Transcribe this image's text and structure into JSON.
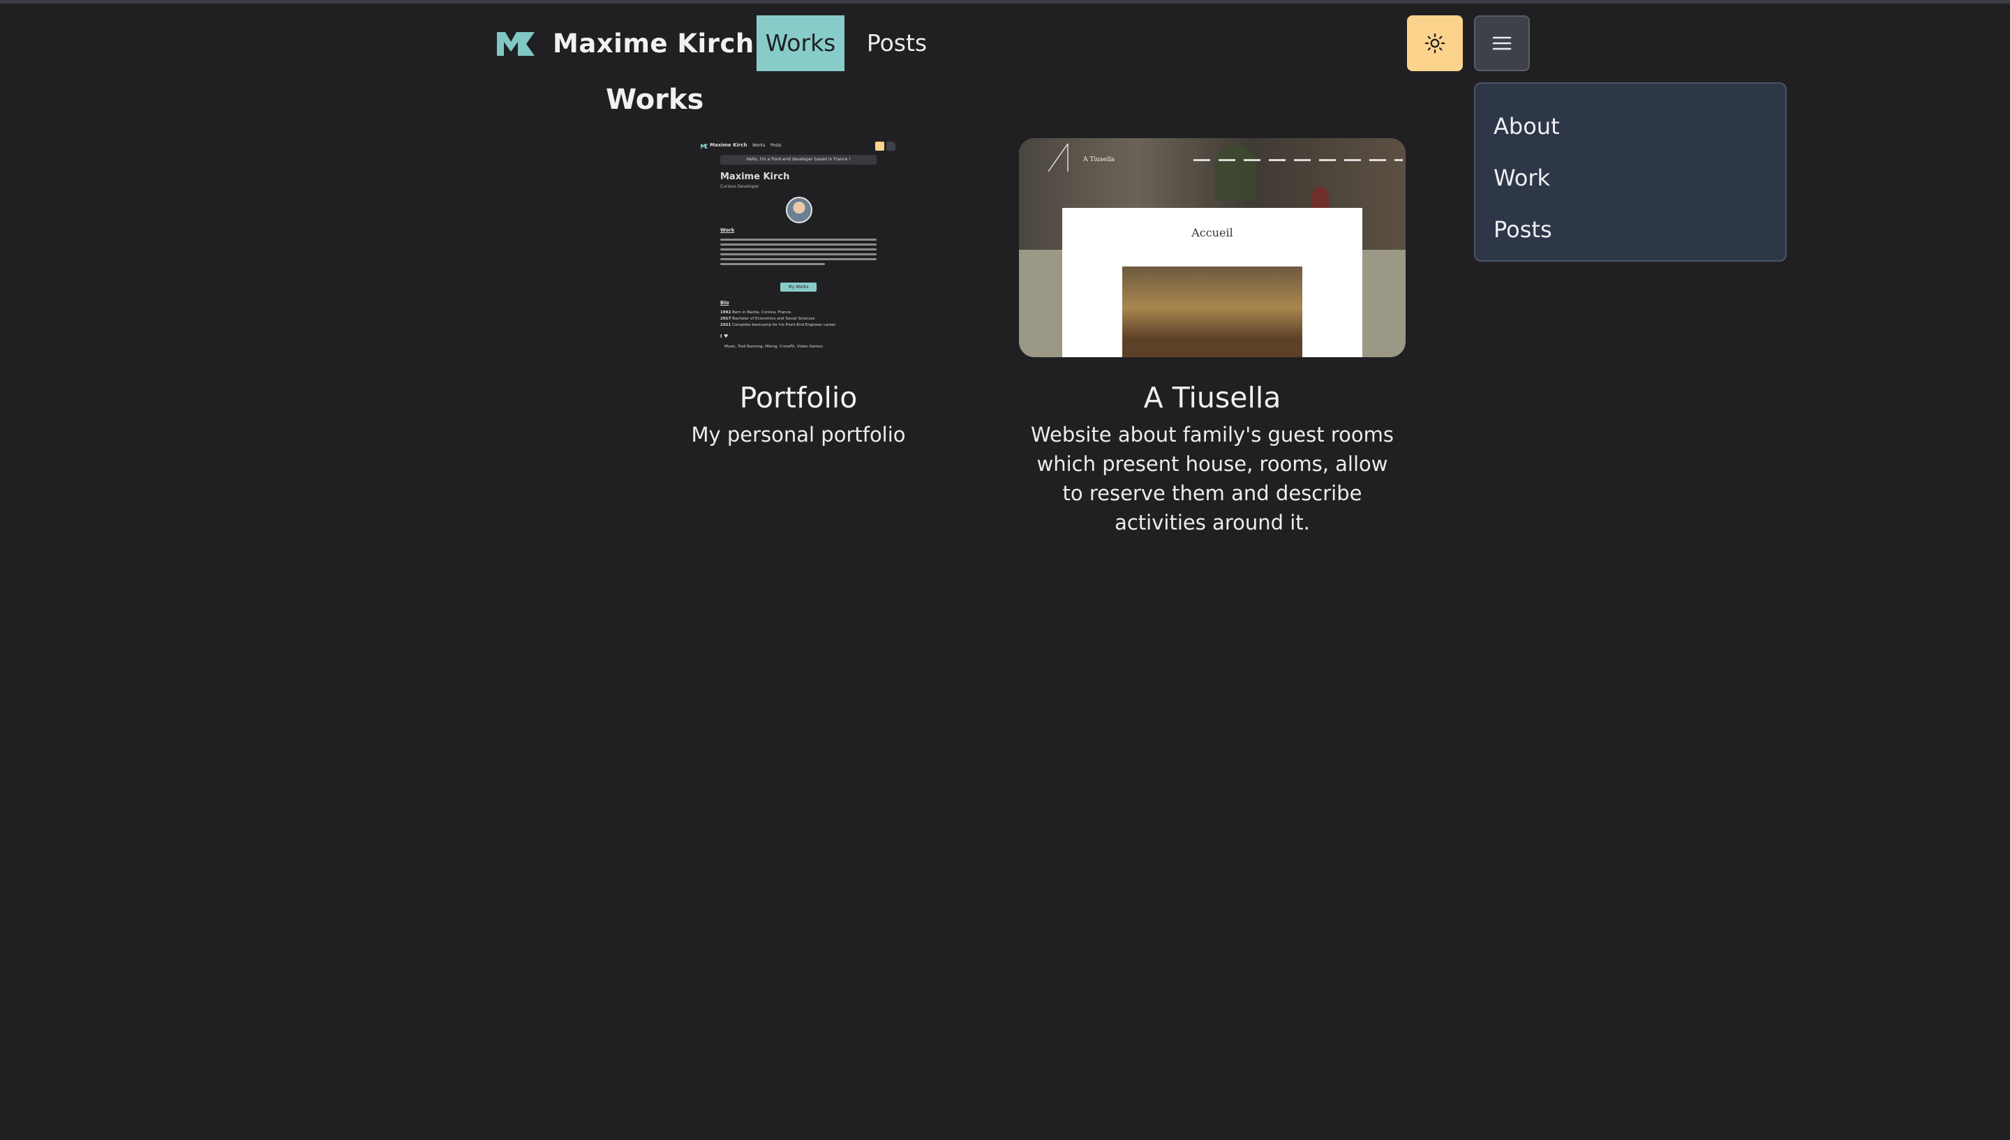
{
  "header": {
    "brand": "Maxime Kirch",
    "nav": [
      {
        "label": "Works",
        "active": true
      },
      {
        "label": "Posts",
        "active": false
      }
    ],
    "theme_toggle_icon": "sun-icon",
    "menu_icon": "hamburger-icon"
  },
  "dropdown": {
    "items": [
      {
        "label": "About"
      },
      {
        "label": "Work"
      },
      {
        "label": "Posts"
      }
    ]
  },
  "main": {
    "title": "Works",
    "cards": [
      {
        "title": "Portfolio",
        "description": "My personal portfolio",
        "preview": {
          "brand": "Maxime Kirch",
          "nav": [
            "Works",
            "Posts"
          ],
          "tagline": "Hello, I'm a front-end developer based in France !",
          "name": "Maxime Kirch",
          "role": "Curious Developer",
          "section_work": "Work",
          "button": "My Works",
          "section_bio": "Bio",
          "bio": [
            {
              "year": "1992",
              "text": "Born in Bastia, Corsica, France."
            },
            {
              "year": "2017",
              "text": "Bachelor of Economics and Social Sciences"
            },
            {
              "year": "2021",
              "text": "Complete bootcamp for his Front-End Engineer career"
            }
          ],
          "section_love": "I ♥",
          "love": "Music, Trail Running, Hiking, CrossFit, Video Games."
        }
      },
      {
        "title": "A Tiusella",
        "description": "Website about family's guest rooms which present house, rooms, allow to reserve them and describe activities around it.",
        "preview": {
          "brand": "A Tiusella",
          "heading": "Accueil"
        }
      }
    ]
  },
  "colors": {
    "background": "#202023",
    "accent": "#88ccca",
    "theme_button": "#fbd38d",
    "dropdown_bg": "#2d3748"
  }
}
